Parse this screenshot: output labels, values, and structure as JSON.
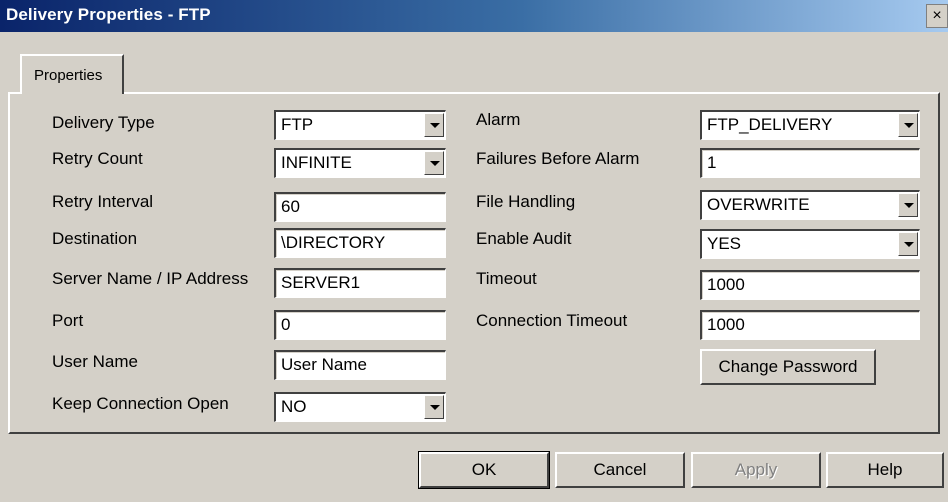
{
  "window": {
    "title": "Delivery Properties - FTP",
    "close_glyph": "×"
  },
  "tabs": [
    {
      "label": "Properties"
    }
  ],
  "left": [
    {
      "label": "Delivery Type",
      "value": "FTP",
      "kind": "combo"
    },
    {
      "label": "Retry Count",
      "value": "INFINITE",
      "kind": "combo"
    },
    {
      "label": "Retry Interval",
      "value": "60",
      "kind": "text"
    },
    {
      "label": "Destination",
      "value": "\\DIRECTORY",
      "kind": "text"
    },
    {
      "label": "Server Name / IP Address",
      "value": "SERVER1",
      "kind": "text"
    },
    {
      "label": "Port",
      "value": "0",
      "kind": "text"
    },
    {
      "label": "User Name",
      "value": "User Name",
      "kind": "text"
    },
    {
      "label": "Keep Connection Open",
      "value": "NO",
      "kind": "combo"
    }
  ],
  "right": [
    {
      "label": "Alarm",
      "value": "FTP_DELIVERY",
      "kind": "combo"
    },
    {
      "label": "Failures Before Alarm",
      "value": "1",
      "kind": "text"
    },
    {
      "label": "File Handling",
      "value": "OVERWRITE",
      "kind": "combo"
    },
    {
      "label": "Enable Audit",
      "value": "YES",
      "kind": "combo"
    },
    {
      "label": "Timeout",
      "value": "1000",
      "kind": "text"
    },
    {
      "label": "Connection Timeout",
      "value": "1000",
      "kind": "text"
    }
  ],
  "change_password": "Change Password",
  "buttons": {
    "ok": "OK",
    "cancel": "Cancel",
    "apply": "Apply",
    "help": "Help"
  }
}
